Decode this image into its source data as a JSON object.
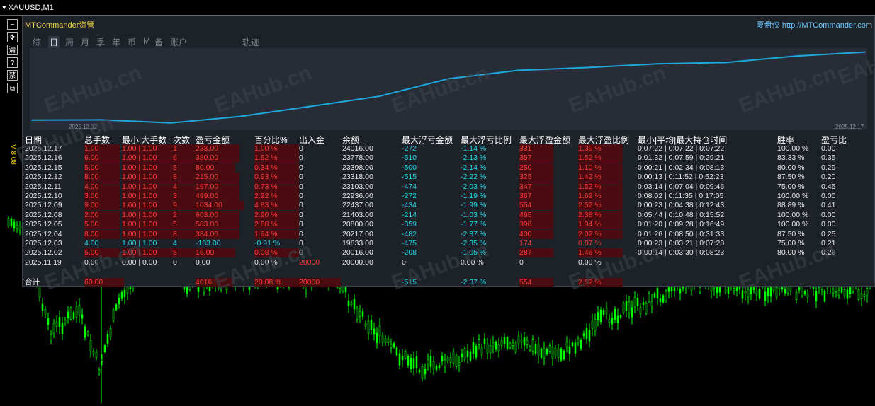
{
  "window": {
    "symbol_title": "XAUUSD,M1"
  },
  "toolbar": {
    "buttons": [
      "−",
      "✥",
      "清",
      "?",
      "禁",
      "⧉"
    ]
  },
  "side_label": "V 8.08",
  "panel": {
    "title": "MTCommander资管",
    "link": "夏盘侠 http://MTCommander.com",
    "tabs": [
      "综",
      "日",
      "周",
      "月",
      "季",
      "年",
      "币",
      "M",
      "备",
      "账户",
      "轨迹"
    ],
    "selected_tab": "日",
    "equity_chart": {
      "start_label": "2025.12.02",
      "end_label": "2025.12.17",
      "x": [
        "2025.11.19",
        "2025.12.02",
        "2025.12.03",
        "2025.12.04",
        "2025.12.05",
        "2025.12.08",
        "2025.12.09",
        "2025.12.10",
        "2025.12.11",
        "2025.12.12",
        "2025.12.15",
        "2025.12.16",
        "2025.12.17"
      ],
      "values": [
        20000,
        20016,
        19833,
        20217,
        20800,
        21403,
        22437,
        22936,
        23103,
        23318,
        23398,
        23778,
        24016
      ],
      "line_color": "#1ea8e0"
    },
    "watermark": "EAHub.cn",
    "columns": [
      "日期",
      "总手数",
      "最小|大手数",
      "次数",
      "盈亏金额",
      "百分比%",
      "出入金",
      "余额",
      "最大浮亏金额",
      "最大浮亏比例",
      "最大浮盈金额",
      "最大浮盈比例",
      "最小|平均|最大持仓时间",
      "胜率",
      "盈亏比"
    ],
    "rows": [
      {
        "date": "2025.12.17",
        "lots": "1.00",
        "minmax": "1.00 | 1.00",
        "count": "1",
        "pnl": "238.00",
        "pct": "1.00 %",
        "io": "0",
        "balance": "24016.00",
        "maxdd": "-272",
        "ddpct": "-1.14 %",
        "maxfp": "331",
        "fppct": "1.39 %",
        "hold": "0:07:22 | 0:07:22 | 0:07:22",
        "win": "100.00 %",
        "rr": "0.00",
        "type": "profit"
      },
      {
        "date": "2025.12.16",
        "lots": "6.00",
        "minmax": "1.00 | 1.00",
        "count": "6",
        "pnl": "380.00",
        "pct": "1.62 %",
        "io": "0",
        "balance": "23778.00",
        "maxdd": "-510",
        "ddpct": "-2.13 %",
        "maxfp": "357",
        "fppct": "1.52 %",
        "hold": "0:01:32 | 0:07:59 | 0:29:21",
        "win": "83.33 %",
        "rr": "0.35",
        "type": "profit"
      },
      {
        "date": "2025.12.15",
        "lots": "5.00",
        "minmax": "1.00 | 1.00",
        "count": "5",
        "pnl": "80.00",
        "pct": "0.34 %",
        "io": "0",
        "balance": "23398.00",
        "maxdd": "-500",
        "ddpct": "-2.14 %",
        "maxfp": "250",
        "fppct": "1.10 %",
        "hold": "0:00:21 | 0:02:34 | 0:08:13",
        "win": "80.00 %",
        "rr": "0.29",
        "type": "profit"
      },
      {
        "date": "2025.12.12",
        "lots": "8.00",
        "minmax": "1.00 | 1.00",
        "count": "8",
        "pnl": "215.00",
        "pct": "0.93 %",
        "io": "0",
        "balance": "23318.00",
        "maxdd": "-515",
        "ddpct": "-2.22 %",
        "maxfp": "325",
        "fppct": "1.42 %",
        "hold": "0:00:13 | 0:11:52 | 0:52:23",
        "win": "87.50 %",
        "rr": "0.20",
        "type": "profit"
      },
      {
        "date": "2025.12.11",
        "lots": "4.00",
        "minmax": "1.00 | 1.00",
        "count": "4",
        "pnl": "167.00",
        "pct": "0.73 %",
        "io": "0",
        "balance": "23103.00",
        "maxdd": "-474",
        "ddpct": "-2.03 %",
        "maxfp": "347",
        "fppct": "1.52 %",
        "hold": "0:03:14 | 0:07:04 | 0:09:46",
        "win": "75.00 %",
        "rr": "0.45",
        "type": "profit"
      },
      {
        "date": "2025.12.10",
        "lots": "3.00",
        "minmax": "1.00 | 1.00",
        "count": "3",
        "pnl": "499.00",
        "pct": "2.22 %",
        "io": "0",
        "balance": "22936.00",
        "maxdd": "-272",
        "ddpct": "-1.19 %",
        "maxfp": "367",
        "fppct": "1.62 %",
        "hold": "0:08:02 | 0:11:35 | 0:17:05",
        "win": "100.00 %",
        "rr": "0.00",
        "type": "profit"
      },
      {
        "date": "2025.12.09",
        "lots": "9.00",
        "minmax": "1.00 | 1.00",
        "count": "9",
        "pnl": "1034.00",
        "pct": "4.83 %",
        "io": "0",
        "balance": "22437.00",
        "maxdd": "-434",
        "ddpct": "-1.99 %",
        "maxfp": "554",
        "fppct": "2.52 %",
        "hold": "0:00:23 | 0:04:38 | 0:12:43",
        "win": "88.89 %",
        "rr": "0.41",
        "type": "profit"
      },
      {
        "date": "2025.12.08",
        "lots": "2.00",
        "minmax": "1.00 | 1.00",
        "count": "2",
        "pnl": "603.00",
        "pct": "2.90 %",
        "io": "0",
        "balance": "21403.00",
        "maxdd": "-214",
        "ddpct": "-1.03 %",
        "maxfp": "495",
        "fppct": "2.38 %",
        "hold": "0:05:44 | 0:10:48 | 0:15:52",
        "win": "100.00 %",
        "rr": "0.00",
        "type": "profit"
      },
      {
        "date": "2025.12.05",
        "lots": "5.00",
        "minmax": "1.00 | 1.00",
        "count": "5",
        "pnl": "583.00",
        "pct": "2.88 %",
        "io": "0",
        "balance": "20800.00",
        "maxdd": "-359",
        "ddpct": "-1.77 %",
        "maxfp": "396",
        "fppct": "1.94 %",
        "hold": "0:01:20 | 0:09:28 | 0:16:49",
        "win": "100.00 %",
        "rr": "0.00",
        "type": "profit"
      },
      {
        "date": "2025.12.04",
        "lots": "8.00",
        "minmax": "1.00 | 1.00",
        "count": "8",
        "pnl": "384.00",
        "pct": "1.94 %",
        "io": "0",
        "balance": "20217.00",
        "maxdd": "-482",
        "ddpct": "-2.37 %",
        "maxfp": "400",
        "fppct": "2.02 %",
        "hold": "0:01:26 | 0:08:50 | 0:31:33",
        "win": "87.50 %",
        "rr": "0.25",
        "type": "profit"
      },
      {
        "date": "2025.12.03",
        "lots": "4.00",
        "minmax": "1.00 | 1.00",
        "count": "4",
        "pnl": "-183.00",
        "pct": "-0.91 %",
        "io": "0",
        "balance": "19833.00",
        "maxdd": "-475",
        "ddpct": "-2.35 %",
        "maxfp": "174",
        "fppct": "0.87 %",
        "hold": "0:00:23 | 0:03:21 | 0:07:28",
        "win": "75.00 %",
        "rr": "0.21",
        "type": "loss"
      },
      {
        "date": "2025.12.02",
        "lots": "5.00",
        "minmax": "1.00 | 1.00",
        "count": "5",
        "pnl": "16.00",
        "pct": "0.08 %",
        "io": "0",
        "balance": "20016.00",
        "maxdd": "-208",
        "ddpct": "-1.05 %",
        "maxfp": "287",
        "fppct": "1.46 %",
        "hold": "0:00:14 | 0:03:30 | 0:08:23",
        "win": "80.00 %",
        "rr": "0.26",
        "type": "profit"
      },
      {
        "date": "2025.11.19",
        "lots": "0.00",
        "minmax": "0.00 | 0.00",
        "count": "0",
        "pnl": "0.00",
        "pct": "0.00 %",
        "io": "20000",
        "balance": "20000.00",
        "maxdd": "0",
        "ddpct": "0.00 %",
        "maxfp": "0",
        "fppct": "0.00 %",
        "hold": "",
        "win": "",
        "rr": "",
        "type": "neutral"
      }
    ],
    "total": {
      "date": "合计",
      "lots": "60.00",
      "pnl": "4016",
      "pct": "20.08 %",
      "io": "20000",
      "maxdd": "-515",
      "ddpct": "-2.37 %",
      "maxfp": "554",
      "fppct": "2.52 %"
    }
  },
  "colors": {
    "profit": "#ff3a3a",
    "loss": "#20d8e8",
    "neutral": "#e8e8e8",
    "highlight": "#4a0c10",
    "header_text": "#ffffff",
    "candle": "#00ff00",
    "panel_bg": "#1d2229",
    "equity_line": "#1ea8e0"
  }
}
